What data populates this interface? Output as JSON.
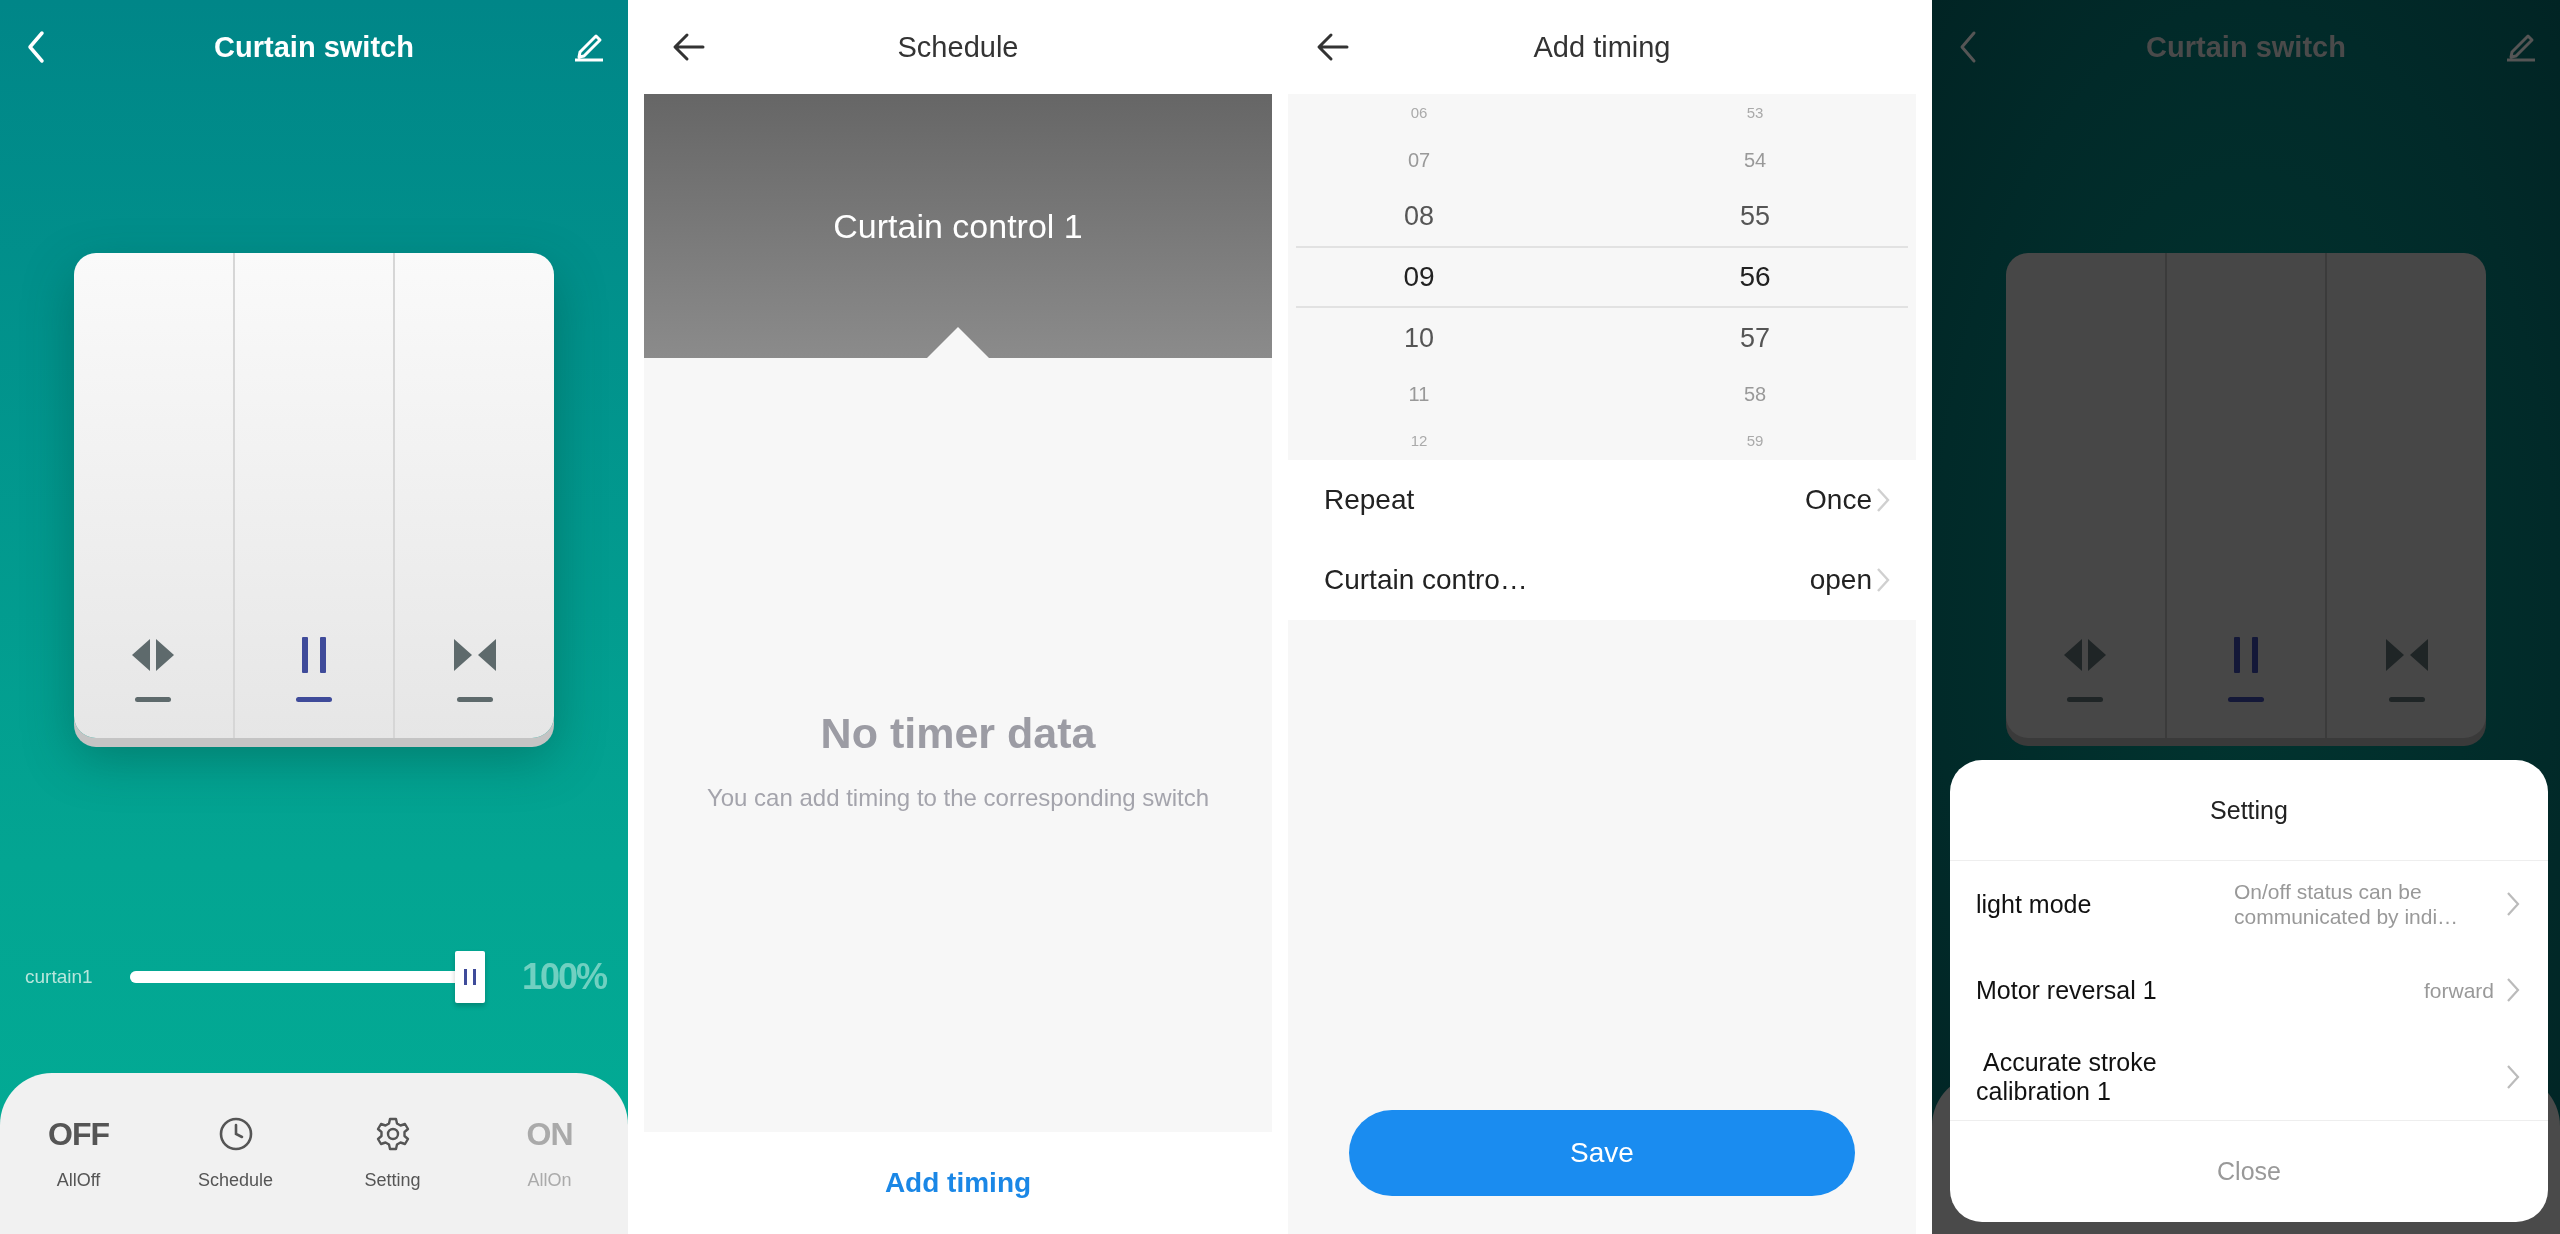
{
  "switch_screen": {
    "title": "Curtain switch",
    "switch_buttons": [
      {
        "kind": "open",
        "selected": false
      },
      {
        "kind": "pause",
        "selected": true
      },
      {
        "kind": "close",
        "selected": false
      }
    ],
    "slider": {
      "label": "curtain1",
      "level": 1.0,
      "reading": "100%"
    },
    "bottom_bar": [
      {
        "kind": "text",
        "icon_text": "OFF",
        "label": "AllOff",
        "disabled": false
      },
      {
        "kind": "clock",
        "label": "Schedule",
        "disabled": false
      },
      {
        "kind": "gear",
        "label": "Setting",
        "disabled": false
      },
      {
        "kind": "text",
        "icon_text": "ON",
        "label": "AllOn",
        "disabled": true
      }
    ]
  },
  "schedule_screen": {
    "title": "Schedule",
    "banner": "Curtain control 1",
    "empty_title": "No timer data",
    "empty_text": "You can add timing to the corresponding switch",
    "action": "Add timing"
  },
  "add_timing_screen": {
    "title": "Add timing",
    "hours": [
      {
        "value": "06",
        "selected": false
      },
      {
        "value": "07",
        "selected": false
      },
      {
        "value": "08",
        "selected": false
      },
      {
        "value": "09",
        "selected": true
      },
      {
        "value": "10",
        "selected": false
      },
      {
        "value": "11",
        "selected": false
      },
      {
        "value": "12",
        "selected": false
      }
    ],
    "minutes": [
      {
        "value": "53",
        "selected": false
      },
      {
        "value": "54",
        "selected": false
      },
      {
        "value": "55",
        "selected": false
      },
      {
        "value": "56",
        "selected": true
      },
      {
        "value": "57",
        "selected": false
      },
      {
        "value": "58",
        "selected": false
      },
      {
        "value": "59",
        "selected": false
      }
    ],
    "rows": [
      {
        "label": "Repeat",
        "value": "Once"
      },
      {
        "label": "Curtain contro…",
        "value": "open"
      }
    ],
    "save": "Save"
  },
  "settings_screen": {
    "title": "Curtain switch",
    "switch_buttons": [
      {
        "kind": "open",
        "selected": false
      },
      {
        "kind": "pause",
        "selected": true
      },
      {
        "kind": "close",
        "selected": false
      }
    ],
    "sheet": {
      "title": "Setting",
      "items": [
        {
          "label": "light mode",
          "value": "On/off status can be communicated by indi…"
        },
        {
          "label": "Motor reversal 1",
          "value": "forward"
        },
        {
          "label": " Accurate stroke calibration 1"
        }
      ],
      "close": "Close"
    }
  }
}
